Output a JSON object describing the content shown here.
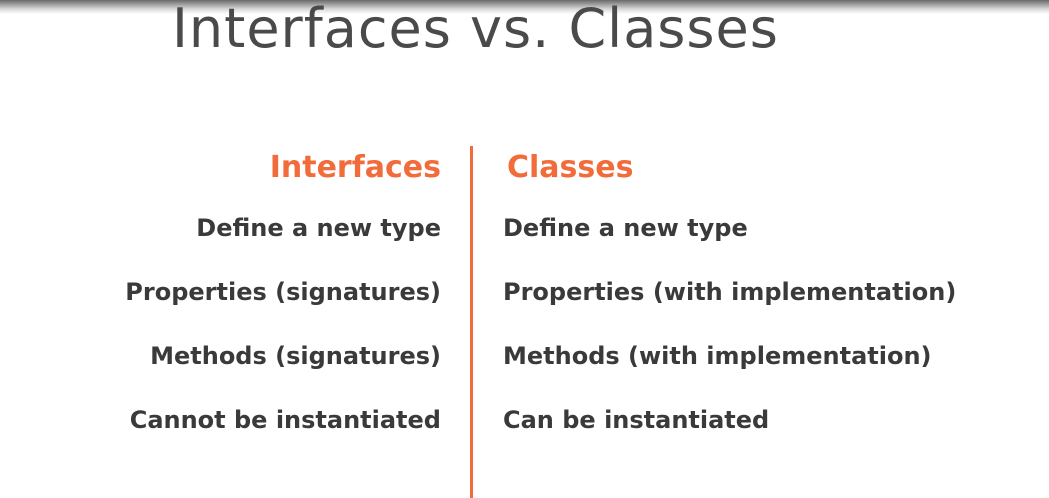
{
  "title": "Interfaces vs. Classes",
  "columns": {
    "left": {
      "header": "Interfaces",
      "rows": [
        "Define a new type",
        "Properties (signatures)",
        "Methods (signatures)",
        "Cannot be instantiated"
      ]
    },
    "right": {
      "header": "Classes",
      "rows": [
        "Define a new type",
        "Properties (with implementation)",
        "Methods (with implementation)",
        "Can be instantiated"
      ]
    }
  },
  "colors": {
    "accent": "#f26b3a",
    "title": "#4a4a4a",
    "body_text": "#3a3a3a",
    "background": "#ffffff"
  }
}
